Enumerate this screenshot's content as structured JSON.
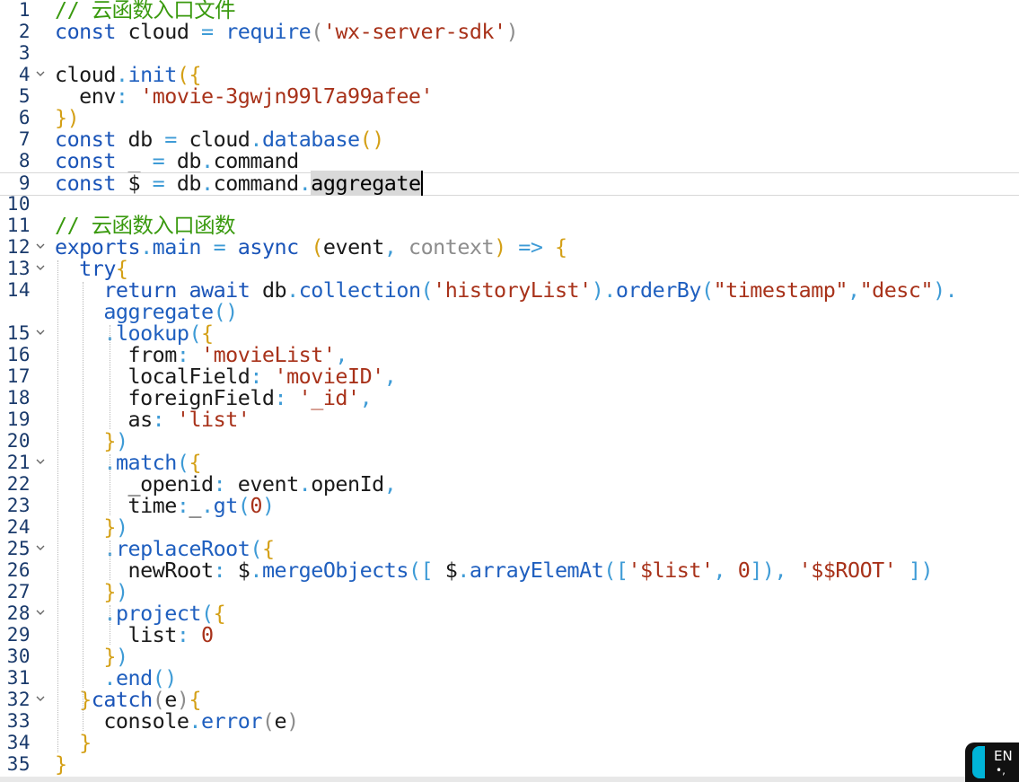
{
  "editor": {
    "current_line": 9,
    "lines": [
      {
        "n": "1",
        "fold": false,
        "tokens": [
          [
            "com",
            "// 云函数入口文件"
          ]
        ]
      },
      {
        "n": "2",
        "fold": false,
        "tokens": [
          [
            "kw",
            "const"
          ],
          [
            "txt",
            " cloud "
          ],
          [
            "pun",
            "="
          ],
          [
            "txt",
            " "
          ],
          [
            "fn",
            "require"
          ],
          [
            "par",
            "("
          ],
          [
            "str",
            "'wx-server-sdk'"
          ],
          [
            "par",
            ")"
          ]
        ]
      },
      {
        "n": "3",
        "fold": false,
        "tokens": []
      },
      {
        "n": "4",
        "fold": true,
        "tokens": [
          [
            "txt",
            "cloud"
          ],
          [
            "pun",
            "."
          ],
          [
            "fn",
            "init"
          ],
          [
            "yel",
            "("
          ],
          [
            "yel",
            "{"
          ]
        ]
      },
      {
        "n": "5",
        "fold": false,
        "tokens": [
          [
            "txt",
            "  env"
          ],
          [
            "pun",
            ":"
          ],
          [
            "txt",
            " "
          ],
          [
            "str",
            "'movie-3gwjn99l7a99afee'"
          ]
        ]
      },
      {
        "n": "6",
        "fold": false,
        "tokens": [
          [
            "yel",
            "}"
          ],
          [
            "yel",
            ")"
          ]
        ]
      },
      {
        "n": "7",
        "fold": false,
        "tokens": [
          [
            "kw",
            "const"
          ],
          [
            "txt",
            " db "
          ],
          [
            "pun",
            "="
          ],
          [
            "txt",
            " cloud"
          ],
          [
            "pun",
            "."
          ],
          [
            "fn",
            "database"
          ],
          [
            "yel",
            "()"
          ]
        ]
      },
      {
        "n": "8",
        "fold": false,
        "tokens": [
          [
            "kw",
            "const"
          ],
          [
            "txt",
            " _ "
          ],
          [
            "pun",
            "="
          ],
          [
            "txt",
            " db"
          ],
          [
            "pun",
            "."
          ],
          [
            "txt",
            "command"
          ]
        ]
      },
      {
        "n": "9",
        "fold": false,
        "tokens": [
          [
            "kw",
            "const"
          ],
          [
            "txt",
            " $ "
          ],
          [
            "pun",
            "="
          ],
          [
            "txt",
            " db"
          ],
          [
            "pun",
            "."
          ],
          [
            "txt",
            "command"
          ],
          [
            "pun",
            "."
          ],
          [
            "sel",
            "aggregate"
          ]
        ]
      },
      {
        "n": "10",
        "fold": false,
        "tokens": []
      },
      {
        "n": "11",
        "fold": false,
        "tokens": [
          [
            "com",
            "// 云函数入口函数"
          ]
        ]
      },
      {
        "n": "12",
        "fold": true,
        "tokens": [
          [
            "kw",
            "exports"
          ],
          [
            "pun",
            "."
          ],
          [
            "fn",
            "main"
          ],
          [
            "txt",
            " "
          ],
          [
            "pun",
            "="
          ],
          [
            "txt",
            " "
          ],
          [
            "kw",
            "async"
          ],
          [
            "txt",
            " "
          ],
          [
            "yel",
            "("
          ],
          [
            "txt",
            "event"
          ],
          [
            "pun",
            ","
          ],
          [
            "txt",
            " "
          ],
          [
            "par",
            "context"
          ],
          [
            "yel",
            ")"
          ],
          [
            "txt",
            " "
          ],
          [
            "pun",
            "=>"
          ],
          [
            "txt",
            " "
          ],
          [
            "yel",
            "{"
          ]
        ]
      },
      {
        "n": "13",
        "fold": true,
        "tokens": [
          [
            "txt",
            "  "
          ],
          [
            "kw",
            "try"
          ],
          [
            "yel",
            "{"
          ]
        ]
      },
      {
        "n": "14",
        "fold": false,
        "tokens": [
          [
            "txt",
            "    "
          ],
          [
            "kw",
            "return"
          ],
          [
            "txt",
            " "
          ],
          [
            "kw",
            "await"
          ],
          [
            "txt",
            " db"
          ],
          [
            "pun",
            "."
          ],
          [
            "fn",
            "collection"
          ],
          [
            "pun",
            "("
          ],
          [
            "str",
            "'historyList'"
          ],
          [
            "pun",
            ")"
          ],
          [
            "pun",
            "."
          ],
          [
            "fn",
            "orderBy"
          ],
          [
            "pun",
            "("
          ],
          [
            "str",
            "\"timestamp\""
          ],
          [
            "pun",
            ","
          ],
          [
            "str",
            "\"desc\""
          ],
          [
            "pun",
            ")"
          ],
          [
            "pun",
            "."
          ]
        ]
      },
      {
        "n": "",
        "fold": false,
        "tokens": [
          [
            "txt",
            "    "
          ],
          [
            "fn",
            "aggregate"
          ],
          [
            "pun",
            "()"
          ]
        ]
      },
      {
        "n": "15",
        "fold": true,
        "tokens": [
          [
            "txt",
            "    "
          ],
          [
            "pun",
            "."
          ],
          [
            "fn",
            "lookup"
          ],
          [
            "pun",
            "("
          ],
          [
            "yel",
            "{"
          ]
        ]
      },
      {
        "n": "16",
        "fold": false,
        "tokens": [
          [
            "txt",
            "      from"
          ],
          [
            "pun",
            ":"
          ],
          [
            "txt",
            " "
          ],
          [
            "str",
            "'movieList'"
          ],
          [
            "pun",
            ","
          ]
        ]
      },
      {
        "n": "17",
        "fold": false,
        "tokens": [
          [
            "txt",
            "      localField"
          ],
          [
            "pun",
            ":"
          ],
          [
            "txt",
            " "
          ],
          [
            "str",
            "'movieID'"
          ],
          [
            "pun",
            ","
          ]
        ]
      },
      {
        "n": "18",
        "fold": false,
        "tokens": [
          [
            "txt",
            "      foreignField"
          ],
          [
            "pun",
            ":"
          ],
          [
            "txt",
            " "
          ],
          [
            "str",
            "'_id'"
          ],
          [
            "pun",
            ","
          ]
        ]
      },
      {
        "n": "19",
        "fold": false,
        "tokens": [
          [
            "txt",
            "      as"
          ],
          [
            "pun",
            ":"
          ],
          [
            "txt",
            " "
          ],
          [
            "str",
            "'list'"
          ]
        ]
      },
      {
        "n": "20",
        "fold": false,
        "tokens": [
          [
            "txt",
            "    "
          ],
          [
            "yel",
            "}"
          ],
          [
            "pun",
            ")"
          ]
        ]
      },
      {
        "n": "21",
        "fold": true,
        "tokens": [
          [
            "txt",
            "    "
          ],
          [
            "pun",
            "."
          ],
          [
            "fn",
            "match"
          ],
          [
            "pun",
            "("
          ],
          [
            "yel",
            "{"
          ]
        ]
      },
      {
        "n": "22",
        "fold": false,
        "tokens": [
          [
            "txt",
            "      _openid"
          ],
          [
            "pun",
            ":"
          ],
          [
            "txt",
            " event"
          ],
          [
            "pun",
            "."
          ],
          [
            "txt",
            "openId"
          ],
          [
            "pun",
            ","
          ]
        ]
      },
      {
        "n": "23",
        "fold": false,
        "tokens": [
          [
            "txt",
            "      time"
          ],
          [
            "pun",
            ":"
          ],
          [
            "txt",
            "_"
          ],
          [
            "pun",
            "."
          ],
          [
            "fn",
            "gt"
          ],
          [
            "pun",
            "("
          ],
          [
            "num",
            "0"
          ],
          [
            "pun",
            ")"
          ]
        ]
      },
      {
        "n": "24",
        "fold": false,
        "tokens": [
          [
            "txt",
            "    "
          ],
          [
            "yel",
            "}"
          ],
          [
            "pun",
            ")"
          ]
        ]
      },
      {
        "n": "25",
        "fold": true,
        "tokens": [
          [
            "txt",
            "    "
          ],
          [
            "pun",
            "."
          ],
          [
            "fn",
            "replaceRoot"
          ],
          [
            "pun",
            "("
          ],
          [
            "yel",
            "{"
          ]
        ]
      },
      {
        "n": "26",
        "fold": false,
        "tokens": [
          [
            "txt",
            "      newRoot"
          ],
          [
            "pun",
            ":"
          ],
          [
            "txt",
            " $"
          ],
          [
            "pun",
            "."
          ],
          [
            "fn",
            "mergeObjects"
          ],
          [
            "pun",
            "(["
          ],
          [
            "txt",
            " $"
          ],
          [
            "pun",
            "."
          ],
          [
            "fn",
            "arrayElemAt"
          ],
          [
            "pun",
            "(["
          ],
          [
            "str",
            "'$list'"
          ],
          [
            "pun",
            ","
          ],
          [
            "txt",
            " "
          ],
          [
            "num",
            "0"
          ],
          [
            "pun",
            "])"
          ],
          [
            "pun",
            ","
          ],
          [
            "txt",
            " "
          ],
          [
            "str",
            "'$$ROOT'"
          ],
          [
            "txt",
            " "
          ],
          [
            "pun",
            "])"
          ]
        ]
      },
      {
        "n": "27",
        "fold": false,
        "tokens": [
          [
            "txt",
            "    "
          ],
          [
            "yel",
            "}"
          ],
          [
            "pun",
            ")"
          ]
        ]
      },
      {
        "n": "28",
        "fold": true,
        "tokens": [
          [
            "txt",
            "    "
          ],
          [
            "pun",
            "."
          ],
          [
            "fn",
            "project"
          ],
          [
            "pun",
            "("
          ],
          [
            "yel",
            "{"
          ]
        ]
      },
      {
        "n": "29",
        "fold": false,
        "tokens": [
          [
            "txt",
            "      list"
          ],
          [
            "pun",
            ":"
          ],
          [
            "txt",
            " "
          ],
          [
            "num",
            "0"
          ]
        ]
      },
      {
        "n": "30",
        "fold": false,
        "tokens": [
          [
            "txt",
            "    "
          ],
          [
            "yel",
            "}"
          ],
          [
            "pun",
            ")"
          ]
        ]
      },
      {
        "n": "31",
        "fold": false,
        "tokens": [
          [
            "txt",
            "    "
          ],
          [
            "pun",
            "."
          ],
          [
            "fn",
            "end"
          ],
          [
            "pun",
            "()"
          ]
        ]
      },
      {
        "n": "32",
        "fold": true,
        "tokens": [
          [
            "txt",
            "  "
          ],
          [
            "yel",
            "}"
          ],
          [
            "kw",
            "catch"
          ],
          [
            "par",
            "("
          ],
          [
            "txt",
            "e"
          ],
          [
            "par",
            ")"
          ],
          [
            "yel",
            "{"
          ]
        ]
      },
      {
        "n": "33",
        "fold": false,
        "tokens": [
          [
            "txt",
            "    console"
          ],
          [
            "pun",
            "."
          ],
          [
            "fn",
            "error"
          ],
          [
            "par",
            "("
          ],
          [
            "txt",
            "e"
          ],
          [
            "par",
            ")"
          ]
        ]
      },
      {
        "n": "34",
        "fold": false,
        "tokens": [
          [
            "txt",
            "  "
          ],
          [
            "yel",
            "}"
          ]
        ]
      },
      {
        "n": "35",
        "fold": false,
        "tokens": [
          [
            "yel",
            "}"
          ]
        ]
      }
    ]
  },
  "ime": {
    "label": "EN",
    "dots": "•,"
  },
  "colors": {
    "comment": "#3a9a0f",
    "keyword": "#1a54b8",
    "string": "#a8321a",
    "punctuation": "#3e9bd6",
    "bracket": "#d4a017"
  },
  "icons": {
    "fold": "chevron-down-icon",
    "ime": "game-controller-icon"
  }
}
